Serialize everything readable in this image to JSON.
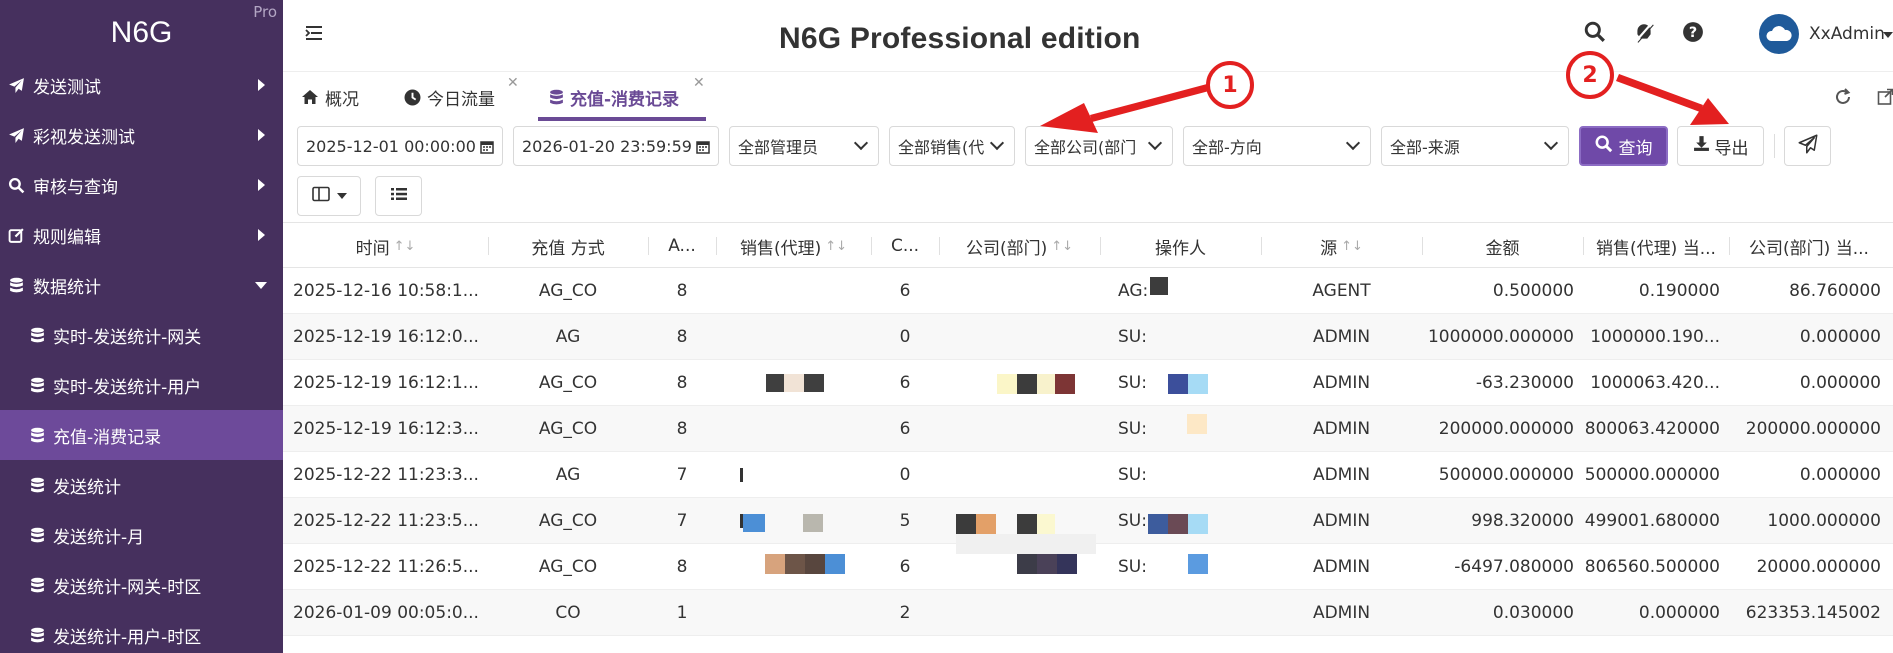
{
  "sidebar": {
    "brand": "N6G",
    "edition_badge": "Pro",
    "items": [
      {
        "label": "发送测试",
        "icon": "paper-plane-icon"
      },
      {
        "label": "彩视发送测试",
        "icon": "paper-plane-icon"
      },
      {
        "label": "审核与查询",
        "icon": "search-icon"
      },
      {
        "label": "规则编辑",
        "icon": "edit-icon"
      },
      {
        "label": "数据统计",
        "icon": "database-icon"
      }
    ],
    "subitems": [
      {
        "label": "实时-发送统计-网关"
      },
      {
        "label": "实时-发送统计-用户"
      },
      {
        "label": "充值-消费记录",
        "active": true
      },
      {
        "label": "发送统计"
      },
      {
        "label": "发送统计-月"
      },
      {
        "label": "发送统计-网关-时区"
      },
      {
        "label": "发送统计-用户-时区"
      }
    ]
  },
  "header": {
    "title": "N6G Professional edition",
    "username": "XxAdmin"
  },
  "tabs": [
    {
      "label": "概况",
      "icon": "home-icon"
    },
    {
      "label": "今日流量",
      "icon": "clock-icon",
      "closable": true
    },
    {
      "label": "充值-消费记录",
      "icon": "database-icon",
      "closable": true,
      "active": true
    }
  ],
  "filters": {
    "start_date": "2025-12-01 00:00:00",
    "end_date": "2026-01-20 23:59:59",
    "admin": "全部管理员",
    "sales": "全部销售(代",
    "company": "全部公司(部门",
    "direction": "全部-方向",
    "source": "全部-来源",
    "query_label": "查询",
    "export_label": "导出"
  },
  "annotations": {
    "marker1": "1",
    "marker2": "2"
  },
  "table": {
    "columns": [
      "时间",
      "充值 方式",
      "A...",
      "销售(代理)",
      "C...",
      "公司(部门)",
      "操作人",
      "源",
      "金额",
      "销售(代理) 当...",
      "公司(部门) 当..."
    ],
    "rows": [
      {
        "time": "2025-12-16 10:58:1...",
        "method": "AG_CO",
        "a": "8",
        "c": "6",
        "op": "AG:",
        "src": "AGENT",
        "amount": "0.500000",
        "sales_bal": "0.190000",
        "company_bal": "86.760000"
      },
      {
        "time": "2025-12-19 16:12:0...",
        "method": "AG",
        "a": "8",
        "c": "0",
        "op": "SU:",
        "src": "ADMIN",
        "amount": "1000000.000000",
        "sales_bal": "1000000.190...",
        "company_bal": "0.000000"
      },
      {
        "time": "2025-12-19 16:12:1...",
        "method": "AG_CO",
        "a": "8",
        "c": "6",
        "op": "SU:",
        "src": "ADMIN",
        "amount": "-63.230000",
        "sales_bal": "1000063.420...",
        "company_bal": "0.000000"
      },
      {
        "time": "2025-12-19 16:12:3...",
        "method": "AG_CO",
        "a": "8",
        "c": "6",
        "op": "SU:",
        "src": "ADMIN",
        "amount": "200000.000000",
        "sales_bal": "800063.420000",
        "company_bal": "200000.000000"
      },
      {
        "time": "2025-12-22 11:23:3...",
        "method": "AG",
        "a": "7",
        "c": "0",
        "op": "SU:",
        "src": "ADMIN",
        "amount": "500000.000000",
        "sales_bal": "500000.000000",
        "company_bal": "0.000000"
      },
      {
        "time": "2025-12-22 11:23:5...",
        "method": "AG_CO",
        "a": "7",
        "c": "5",
        "op": "SU:",
        "src": "ADMIN",
        "amount": "998.320000",
        "sales_bal": "499001.680000",
        "company_bal": "1000.000000"
      },
      {
        "time": "2025-12-22 11:26:5...",
        "method": "AG_CO",
        "a": "8",
        "c": "6",
        "op": "SU:",
        "src": "ADMIN",
        "amount": "-6497.080000",
        "sales_bal": "806560.500000",
        "company_bal": "20000.000000"
      },
      {
        "time": "2026-01-09 00:05:0...",
        "method": "CO",
        "a": "1",
        "c": "2",
        "op": "",
        "src": "ADMIN",
        "amount": "0.030000",
        "sales_bal": "0.000000",
        "company_bal": "623353.145002"
      }
    ]
  },
  "colors": {
    "sidebar_bg": "#46305e",
    "sidebar_active": "#6d4a9a",
    "accent": "#6f49a8",
    "annotation": "#e32020"
  }
}
